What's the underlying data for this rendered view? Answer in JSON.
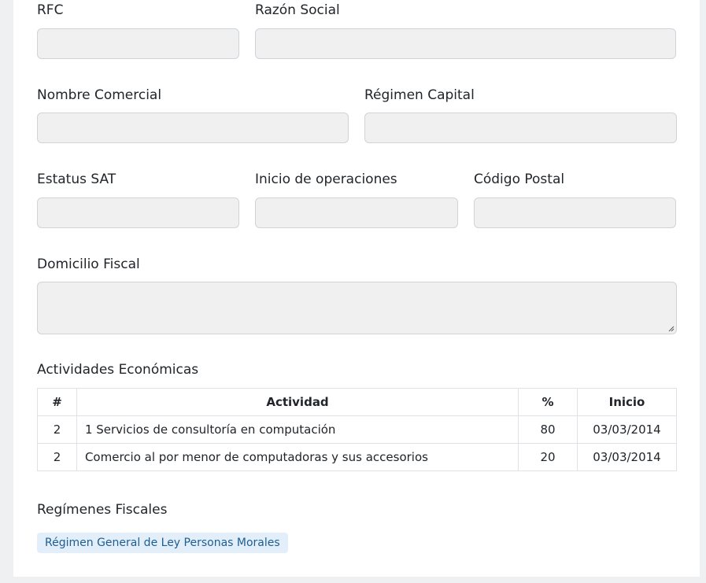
{
  "form": {
    "rfc": {
      "label": "RFC",
      "value": ""
    },
    "razon_social": {
      "label": "Razón Social",
      "value": ""
    },
    "nombre_comercial": {
      "label": "Nombre Comercial",
      "value": ""
    },
    "regimen_capital": {
      "label": "Régimen Capital",
      "value": ""
    },
    "estatus_sat": {
      "label": "Estatus SAT",
      "value": ""
    },
    "inicio_operaciones": {
      "label": "Inicio de operaciones",
      "value": ""
    },
    "codigo_postal": {
      "label": "Código Postal",
      "value": ""
    },
    "domicilio_fiscal": {
      "label": "Domicilio Fiscal",
      "value": ""
    }
  },
  "actividades": {
    "title": "Actividades Económicas",
    "headers": [
      "#",
      "Actividad",
      "%",
      "Inicio"
    ],
    "rows": [
      {
        "num": "2",
        "actividad": "1 Servicios de consultoría en computación",
        "pct": "80",
        "inicio": "03/03/2014"
      },
      {
        "num": "2",
        "actividad": "Comercio al por menor de computadoras y sus accesorios",
        "pct": "20",
        "inicio": "03/03/2014"
      }
    ]
  },
  "regimenes": {
    "title": "Regímenes Fiscales",
    "items": [
      "Régimen General de Ley Personas Morales"
    ]
  },
  "colors": {
    "field_bg": "#f0f0f0",
    "field_border": "#ced4da",
    "badge_bg": "#e2effa",
    "badge_text": "#1f5d8f"
  }
}
